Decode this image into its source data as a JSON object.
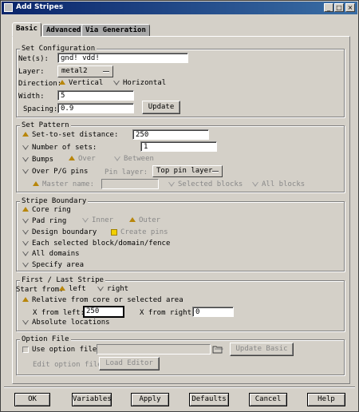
{
  "window": {
    "title": "Add Stripes"
  },
  "tabs": [
    {
      "label": "Basic"
    },
    {
      "label": "Advanced"
    },
    {
      "label": "Via Generation"
    }
  ],
  "set_configuration": {
    "title": "Set Configuration",
    "nets_label": "Net(s):",
    "nets_value": "gnd! vdd!",
    "layer_label": "Layer:",
    "layer_value": "metal2",
    "direction_label": "Direction:",
    "direction_vertical": "Vertical",
    "direction_horizontal": "Horizontal",
    "direction_selected": "Vertical",
    "width_label": "Width:",
    "width_value": "5",
    "spacing_label": "Spacing:",
    "spacing_value": "0.9",
    "update_label": "Update"
  },
  "set_pattern": {
    "title": "Set Pattern",
    "set_to_set_label": "Set-to-set distance:",
    "set_to_set_value": "250",
    "number_of_sets_label": "Number of sets:",
    "number_of_sets_value": "1",
    "bumps_label": "Bumps",
    "over_label": "Over",
    "between_label": "Between",
    "over_pg_label": "Over P/G pins",
    "pin_layer_label": "Pin layer:",
    "pin_layer_value": "Top pin layer",
    "master_name_label": "Master name:",
    "master_name_value": "",
    "selected_blocks_label": "Selected blocks",
    "all_blocks_label": "All blocks",
    "selected": "Set-to-set distance"
  },
  "stripe_boundary": {
    "title": "Stripe Boundary",
    "core_ring": "Core ring",
    "pad_ring": "Pad ring",
    "inner": "Inner",
    "outer": "Outer",
    "design_boundary": "Design boundary",
    "create_pins": "Create pins",
    "create_pins_checked": true,
    "each_selected": "Each selected block/domain/fence",
    "all_domains": "All domains",
    "specify_area": "Specify area",
    "selected": "Core ring"
  },
  "first_last_stripe": {
    "title": "First / Last Stripe",
    "start_from_label": "Start from:",
    "left": "left",
    "right": "right",
    "start_selected": "left",
    "relative_label": "Relative from core or selected area",
    "x_from_left_label": "X from left:",
    "x_from_left_value": "250",
    "x_from_right_label": "X from right:",
    "x_from_right_value": "0",
    "absolute_label": "Absolute locations",
    "selected": "Relative from core or selected area"
  },
  "option_file": {
    "title": "Option File",
    "use_option_file_label": "Use option file:",
    "use_option_file_value": "",
    "update_basic_label": "Update Basic",
    "edit_option_file_label": "Edit option file",
    "load_editor_label": "Load Editor"
  },
  "bottom_buttons": {
    "ok": "OK",
    "variables": "Variables",
    "apply": "Apply",
    "defaults": "Defaults",
    "cancel": "Cancel",
    "help": "Help"
  },
  "icons": {
    "app": "app-icon",
    "minimize": "minimize-icon",
    "maximize": "maximize-icon",
    "close": "close-icon",
    "folder": "folder-icon"
  },
  "colors": {
    "title_bar": "#0a246a",
    "dialog_bg": "#d4d0c8",
    "radio_on": "#b8860b",
    "check_on": "#f2d000"
  }
}
